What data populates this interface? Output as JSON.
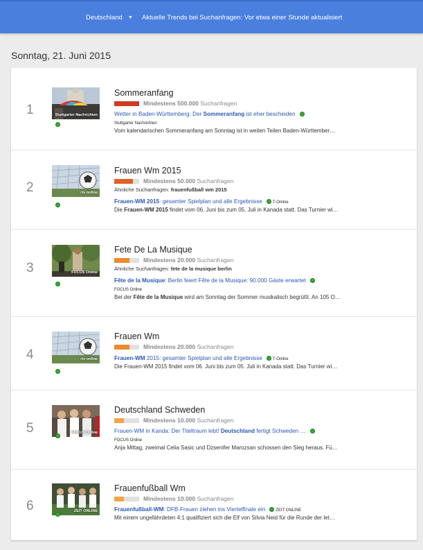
{
  "header": {
    "region": "Deutschland",
    "title": "Aktuelle Trends bei Suchanfragen: Vor etwa einer Stunde aktualisiert"
  },
  "date_heading": "Sonntag, 21. Juni 2015",
  "trends": [
    {
      "rank": "1",
      "title": "Sommeranfang",
      "volume_prefix": "Mindestens",
      "volume": "500.000",
      "volume_suffix": "Suchanfragen",
      "volume_level": 1.0,
      "bar_color": "#cc3a1f",
      "thumb_source": "Stuttgarter Nachrichten",
      "related_label": "",
      "related_value": "",
      "article_pre": "Wetter in Baden-Württemberg: Der ",
      "article_bold": "Sommeranfang",
      "article_post": " ist eher bescheiden",
      "article_pub_inline": "",
      "publisher": "Stuttgarter Nachrichten",
      "desc_pre": "Vom kalendarischen Sommeranfang am Sonntag ist in weiten Teilen Baden-Württember…",
      "desc_bold": "",
      "desc_post": ""
    },
    {
      "rank": "2",
      "title": "Frauen Wm 2015",
      "volume_prefix": "Mindestens",
      "volume": "50.000",
      "volume_suffix": "Suchanfragen",
      "volume_level": 0.75,
      "bar_color": "#e0622a",
      "thumb_source": "rtv online",
      "related_label": "Ähnliche Suchanfragen: ",
      "related_value": "frauenfußball wm 2015",
      "article_pre": "",
      "article_bold": "Frauen-WM 2015",
      "article_post": ": gesamter Spielplan und alle Ergebnisse",
      "article_pub_inline": "T-Online",
      "publisher": "",
      "desc_pre": "Die ",
      "desc_bold": "Frauen-WM 2015",
      "desc_post": " findet vom 06. Juni bis zum 05. Juli in Kanada statt. Das Turnier wi…"
    },
    {
      "rank": "3",
      "title": "Fete De La Musique",
      "volume_prefix": "Mindestens",
      "volume": "20.000",
      "volume_suffix": "Suchanfragen",
      "volume_level": 0.6,
      "bar_color": "#ec8a2e",
      "thumb_source": "FOCUS Online",
      "related_label": "Ähnliche Suchanfragen: ",
      "related_value": "fete de la musique berlin",
      "article_pre": "",
      "article_bold": "Fête de la Musique",
      "article_post": ": Berlin feiert Fête de la Musique: 90.000 Gäste erwartet",
      "article_pub_inline": "",
      "publisher": "FOCUS Online",
      "desc_pre": "Bei der ",
      "desc_bold": "Fête de la Musique",
      "desc_post": " wird am Sonntag der Sommer musikalisch begrüßt. An 105 O…"
    },
    {
      "rank": "4",
      "title": "Frauen Wm",
      "volume_prefix": "Mindestens",
      "volume": "20.000",
      "volume_suffix": "Suchanfragen",
      "volume_level": 0.6,
      "bar_color": "#ec8a2e",
      "thumb_source": "rtv online",
      "related_label": "",
      "related_value": "",
      "article_pre": "",
      "article_bold": "Frauen-WM",
      "article_post": " 2015: gesamter Spielplan und alle Ergebnisse",
      "article_pub_inline": "T-Online",
      "publisher": "",
      "desc_pre": "Die Frauen-WM 2015 findet vom 06. Juni bis zum 05. Juli in Kanada statt. Das Turnier wi…",
      "desc_bold": "",
      "desc_post": ""
    },
    {
      "rank": "5",
      "title": "Deutschland Schweden",
      "volume_prefix": "Mindestens",
      "volume": "10.000",
      "volume_suffix": "Suchanfragen",
      "volume_level": 0.4,
      "bar_color": "#f2a64a",
      "thumb_source": "FOCUS Online",
      "related_label": "",
      "related_value": "",
      "article_pre": "Frauen-WM in Kanda: Der Titeltraum lebt! ",
      "article_bold": "Deutschland",
      "article_post": " fertigt Schweden …",
      "article_pub_inline": "",
      "publisher": "FOCUS Online",
      "desc_pre": "Anja Mittag, zweimal Celia Sasic und Dzsenifer Marozsan schossen den Sieg heraus. Fü…",
      "desc_bold": "",
      "desc_post": ""
    },
    {
      "rank": "6",
      "title": "Frauenfußball Wm",
      "volume_prefix": "Mindestens",
      "volume": "10.000",
      "volume_suffix": "Suchanfragen",
      "volume_level": 0.4,
      "bar_color": "#f2a64a",
      "thumb_source": "ZEIT ONLINE",
      "related_label": "",
      "related_value": "",
      "article_pre": "",
      "article_bold": "Frauenfußball-WM",
      "article_post": ": DFB-Frauen ziehen ins Viertelfinale ein",
      "article_pub_inline": "ZEIT ONLINE",
      "publisher": "",
      "desc_pre": "Mit einem ungefährdeten 4:1 qualifiziert sich die Elf von Silvia Neid für die Runde der let…",
      "desc_bold": "",
      "desc_post": ""
    }
  ]
}
